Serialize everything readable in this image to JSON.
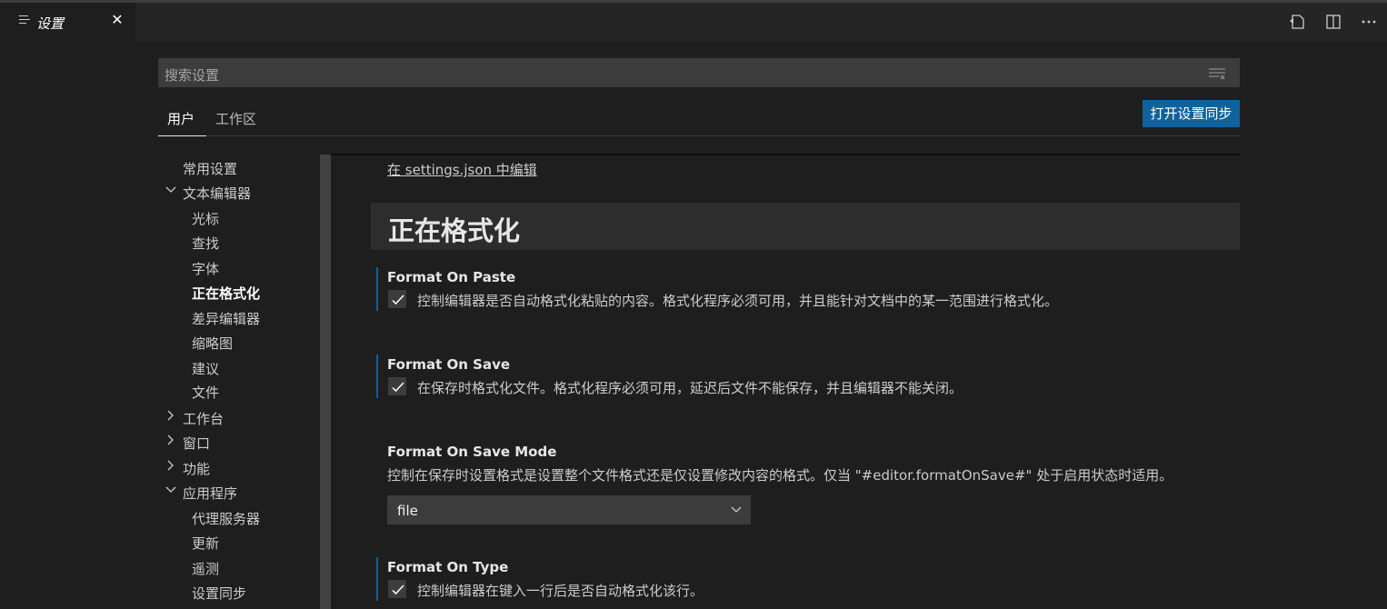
{
  "tab": {
    "title": "设置",
    "close": "✕"
  },
  "search": {
    "placeholder": "搜索设置"
  },
  "scope": {
    "user": "用户",
    "workspace": "工作区",
    "sync_button": "打开设置同步"
  },
  "toc": {
    "items": [
      {
        "label": "常用设置"
      },
      {
        "label": "文本编辑器"
      },
      {
        "label": "光标"
      },
      {
        "label": "查找"
      },
      {
        "label": "字体"
      },
      {
        "label": "正在格式化"
      },
      {
        "label": "差异编辑器"
      },
      {
        "label": "缩略图"
      },
      {
        "label": "建议"
      },
      {
        "label": "文件"
      },
      {
        "label": "工作台"
      },
      {
        "label": "窗口"
      },
      {
        "label": "功能"
      },
      {
        "label": "应用程序"
      },
      {
        "label": "代理服务器"
      },
      {
        "label": "更新"
      },
      {
        "label": "遥测"
      },
      {
        "label": "设置同步"
      }
    ]
  },
  "content": {
    "edit_link": "在 settings.json 中编辑",
    "section_title": "正在格式化",
    "settings": [
      {
        "title": "Format On Paste",
        "description": "控制编辑器是否自动格式化粘贴的内容。格式化程序必须可用，并且能针对文档中的某一范围进行格式化。",
        "checked": true
      },
      {
        "title": "Format On Save",
        "description": "在保存时格式化文件。格式化程序必须可用，延迟后文件不能保存，并且编辑器不能关闭。",
        "checked": true
      },
      {
        "title": "Format On Save Mode",
        "description": "控制在保存时设置格式是设置整个文件格式还是仅设置修改内容的格式。仅当 \"#editor.formatOnSave#\" 处于启用状态时适用。",
        "value": "file"
      },
      {
        "title": "Format On Type",
        "description": "控制编辑器在键入一行后是否自动格式化该行。",
        "checked": true
      }
    ]
  },
  "colors": {
    "accent": "#0e639c",
    "focus_bar": "#007acc",
    "background": "#1e1e1e"
  },
  "icons": [
    "menu-lines-icon",
    "close-icon",
    "open-json-icon",
    "split-editor-icon",
    "more-icon",
    "filter-icon",
    "chevron-down-icon",
    "chevron-right-icon",
    "check-icon"
  ]
}
